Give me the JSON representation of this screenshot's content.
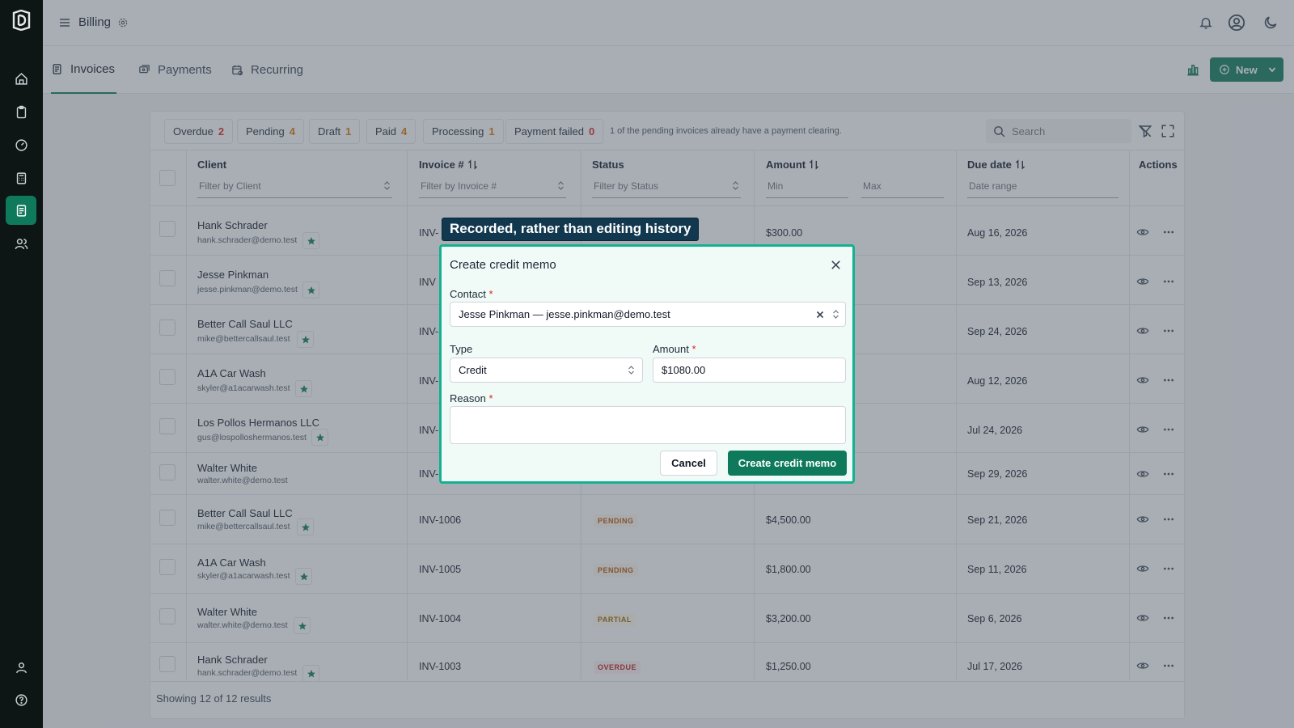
{
  "app": {
    "title": "Billing",
    "accent": "#0e7a5b"
  },
  "sidebar": {
    "items": [
      "home-icon",
      "clipboard-icon",
      "gauge-icon",
      "calculator-icon",
      "document-icon",
      "users-icon"
    ],
    "active": "document-icon",
    "bottom": [
      "user-icon",
      "help-icon"
    ]
  },
  "tabs": [
    {
      "label": "Invoices",
      "active": true
    },
    {
      "label": "Payments",
      "active": false
    },
    {
      "label": "Recurring",
      "active": false
    }
  ],
  "toolbar": {
    "new_label": "New"
  },
  "chips": [
    {
      "label": "Overdue",
      "count": "2"
    },
    {
      "label": "Pending",
      "count": "4"
    },
    {
      "label": "Draft",
      "count": "1"
    },
    {
      "label": "Paid",
      "count": "4"
    },
    {
      "label": "Processing",
      "count": "1"
    },
    {
      "label": "Payment failed",
      "count": "0"
    }
  ],
  "chip_note": "1 of the pending invoices already have a payment clearing.",
  "search": {
    "placeholder": "Search"
  },
  "columns": {
    "client": "Client",
    "invoice": "Invoice #",
    "status": "Status",
    "amount": "Amount",
    "due": "Due date",
    "actions": "Actions"
  },
  "filters": {
    "client": "Filter by Client",
    "invoice": "Filter by Invoice #",
    "status": "Filter by Status",
    "amount_min": "Min",
    "amount_max": "Max",
    "due": "Date range"
  },
  "rows": [
    {
      "name": "Hank Schrader",
      "email": "hank.schrader@demo.test",
      "starred": true,
      "invoice": "INV-",
      "status": "",
      "status_class": "",
      "amount": "$300.00",
      "due": "Aug 16, 2026"
    },
    {
      "name": "Jesse Pinkman",
      "email": "jesse.pinkman@demo.test",
      "starred": true,
      "invoice": "INV",
      "status": "",
      "status_class": "",
      "amount": "",
      "due": "Sep 13, 2026"
    },
    {
      "name": "Better Call Saul LLC",
      "email": "mike@bettercallsaul.test",
      "starred": true,
      "invoice": "INV-",
      "status": "",
      "status_class": "",
      "amount": "",
      "due": "Sep 24, 2026"
    },
    {
      "name": "A1A Car Wash",
      "email": "skyler@a1acarwash.test",
      "starred": true,
      "invoice": "INV-",
      "status": "",
      "status_class": "",
      "amount": "",
      "due": "Aug 12, 2026"
    },
    {
      "name": "Los Pollos Hermanos LLC",
      "email": "gus@lospolloshermanos.test",
      "starred": true,
      "invoice": "INV-",
      "status": "",
      "status_class": "",
      "amount": "",
      "due": "Jul 24, 2026"
    },
    {
      "name": "Walter White",
      "email": "walter.white@demo.test",
      "starred": false,
      "invoice": "INV-",
      "status": "",
      "status_class": "",
      "amount": "",
      "due": "Sep 29, 2026"
    },
    {
      "name": "Better Call Saul LLC",
      "email": "mike@bettercallsaul.test",
      "starred": true,
      "invoice": "INV-1006",
      "status": "PENDING",
      "status_class": "b-pending",
      "amount": "$4,500.00",
      "due": "Sep 21, 2026"
    },
    {
      "name": "A1A Car Wash",
      "email": "skyler@a1acarwash.test",
      "starred": true,
      "invoice": "INV-1005",
      "status": "PENDING",
      "status_class": "b-pending",
      "amount": "$1,800.00",
      "due": "Sep 11, 2026"
    },
    {
      "name": "Walter White",
      "email": "walter.white@demo.test",
      "starred": true,
      "invoice": "INV-1004",
      "status": "PARTIAL",
      "status_class": "b-partial",
      "amount": "$3,200.00",
      "due": "Sep 6, 2026"
    },
    {
      "name": "Hank Schrader",
      "email": "hank.schrader@demo.test",
      "starred": true,
      "invoice": "INV-1003",
      "status": "OVERDUE",
      "status_class": "b-overdue",
      "amount": "$1,250.00",
      "due": "Jul 17, 2026"
    }
  ],
  "footer": "Showing 12 of 12 results",
  "tooltip": "Recorded, rather than editing history",
  "modal": {
    "title": "Create credit memo",
    "contact_label": "Contact",
    "contact_value": "Jesse Pinkman — jesse.pinkman@demo.test",
    "type_label": "Type",
    "type_value": "Credit",
    "amount_label": "Amount",
    "amount_value": "$1080.00",
    "reason_label": "Reason",
    "reason_value": "",
    "required_mark": "*",
    "cancel_label": "Cancel",
    "submit_label": "Create credit memo"
  }
}
